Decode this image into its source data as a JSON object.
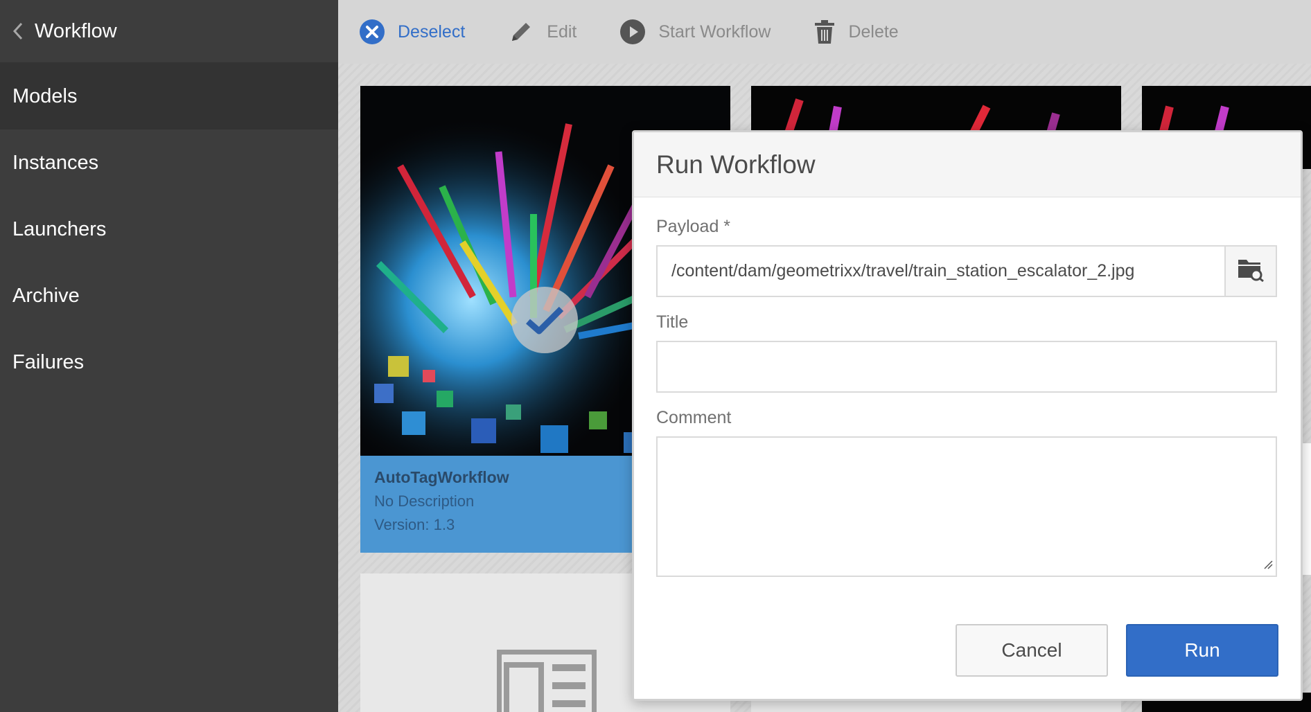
{
  "sidebar": {
    "title": "Workflow",
    "items": [
      {
        "label": "Models"
      },
      {
        "label": "Instances"
      },
      {
        "label": "Launchers"
      },
      {
        "label": "Archive"
      },
      {
        "label": "Failures"
      }
    ]
  },
  "toolbar": {
    "deselect_label": "Deselect",
    "edit_label": "Edit",
    "start_workflow_label": "Start Workflow",
    "delete_label": "Delete"
  },
  "cards": [
    {
      "title": "AutoTagWorkflow",
      "description": "No Description",
      "version": "Version: 1.3",
      "selected": true
    }
  ],
  "dialog": {
    "title": "Run Workflow",
    "payload_label": "Payload *",
    "payload_value": "/content/dam/geometrixx/travel/train_station_escalator_2.jpg",
    "title_label": "Title",
    "title_value": "",
    "comment_label": "Comment",
    "comment_value": "",
    "cancel_label": "Cancel",
    "run_label": "Run"
  },
  "colors": {
    "accent": "#326ec8",
    "sidebar_bg": "#3d3d3d",
    "card_selected": "#4b96d2"
  },
  "icons": [
    "chevron-left-icon",
    "close-circle-icon",
    "pencil-icon",
    "play-circle-icon",
    "trash-icon",
    "folder-search-icon",
    "checkmark-icon",
    "resize-handle-icon"
  ]
}
